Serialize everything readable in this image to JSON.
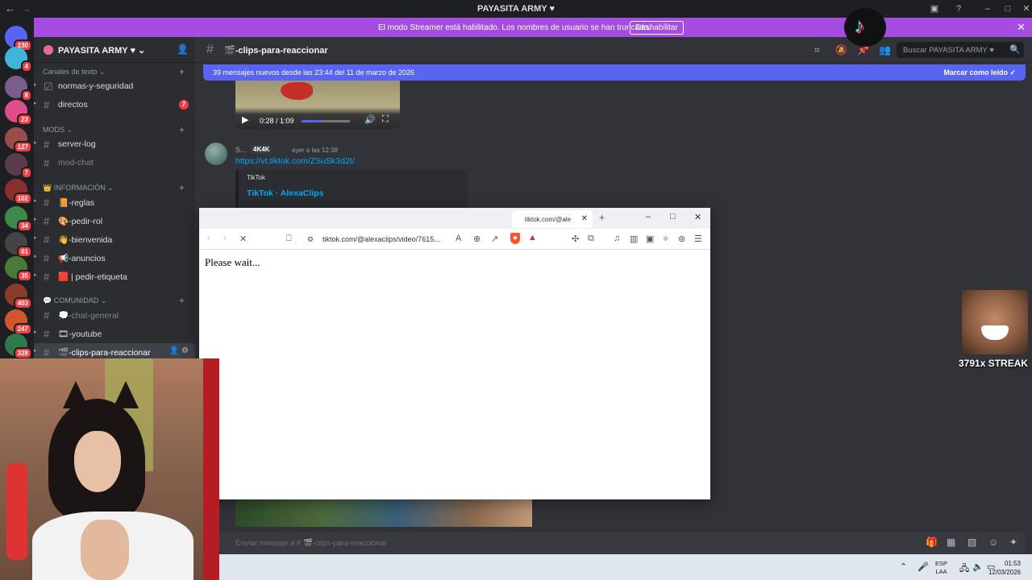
{
  "window": {
    "title": "PAYASITA ARMY ♥"
  },
  "banner": {
    "message": "El modo Streamer está habilitado. Los nombres de usuario se han truncado.",
    "button": "Deshabilitar"
  },
  "rail": {
    "badges": [
      "230",
      "4",
      "8",
      "23",
      "127",
      "7",
      "102",
      "34",
      "61",
      "35",
      "403",
      "247",
      "328"
    ]
  },
  "server": {
    "name": "PAYASITA ARMY ♥"
  },
  "categories": {
    "text": "Canales de texto",
    "mods": "MODS",
    "info": "INFORMACIÓN",
    "community": "COMUNIDAD"
  },
  "channels": {
    "normas": "normas-y-seguridad",
    "directos": "directos",
    "directos_count": "7",
    "serverlog": "server-log",
    "modchat": "mod-chat",
    "reglas": "📙-reglas",
    "pedirrol": "🎨-pedir-rol",
    "bienvenida": "👋-bienvenida",
    "anuncios": "📢-anuncios",
    "etiqueta": "🟥 | pedir-etiqueta",
    "chatgeneral": "💭-chat-general",
    "youtube": "🎞-youtube",
    "clips": "🎬-clips-para-reaccionar"
  },
  "header": {
    "channel": "🎬-clips-para-reaccionar",
    "search_placeholder": "Buscar PAYASITA ARMY ♥"
  },
  "newbar": {
    "text": "39 mensajes nuevos desde las 23:44 del 11 de marzo de 2026",
    "action": "Marcar como leído"
  },
  "video": {
    "time": "0:28 / 1:09",
    "progress": 0.41
  },
  "message": {
    "author": "S...",
    "tag": "4K4K",
    "timestamp": "ayer a las 12:38",
    "link": "https://vt.tiktok.com/ZSuSk3d2t/",
    "embed_provider": "TikTok",
    "embed_title": "TikTok · AlexaClips"
  },
  "composer": {
    "placeholder": "Enviar mensaje a # 🎬-clips-para-reaccionar"
  },
  "browser": {
    "tab_title": "tiktok.com/@ale",
    "url": "tiktok.com/@alexaclips/video/7615...",
    "content": "Please wait..."
  },
  "taskbar": {
    "lang_1": "ESP",
    "lang_2": "LAA",
    "time": "01:53",
    "date": "12/03/2026"
  },
  "overlay": {
    "streak": "3791x STREAK"
  }
}
